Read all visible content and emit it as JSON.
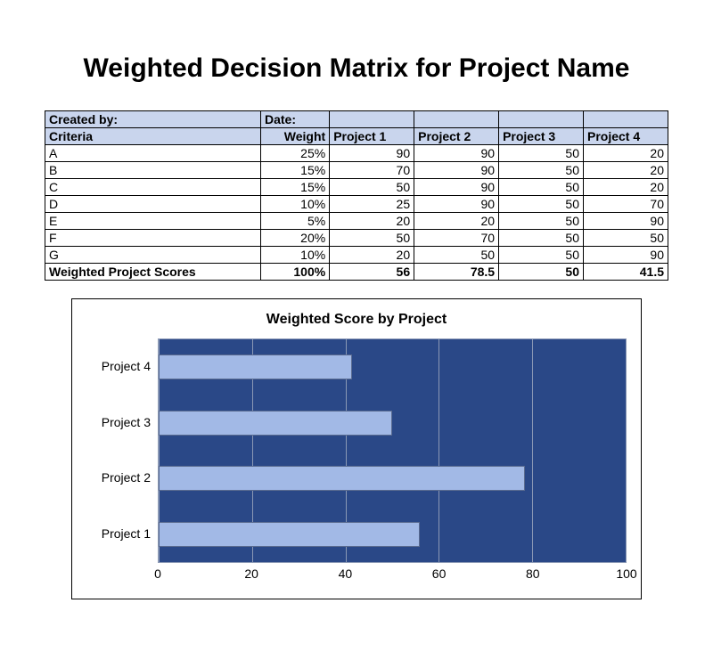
{
  "title": "Weighted Decision Matrix for Project Name",
  "meta": {
    "created_by_label": "Created by:",
    "date_label": "Date:"
  },
  "table": {
    "headers": {
      "criteria": "Criteria",
      "weight": "Weight",
      "p1": "Project 1",
      "p2": "Project 2",
      "p3": "Project 3",
      "p4": "Project 4"
    },
    "rows": [
      {
        "criteria": "A",
        "weight": "25%",
        "p1": "90",
        "p2": "90",
        "p3": "50",
        "p4": "20"
      },
      {
        "criteria": "B",
        "weight": "15%",
        "p1": "70",
        "p2": "90",
        "p3": "50",
        "p4": "20"
      },
      {
        "criteria": "C",
        "weight": "15%",
        "p1": "50",
        "p2": "90",
        "p3": "50",
        "p4": "20"
      },
      {
        "criteria": "D",
        "weight": "10%",
        "p1": "25",
        "p2": "90",
        "p3": "50",
        "p4": "70"
      },
      {
        "criteria": "E",
        "weight": "5%",
        "p1": "20",
        "p2": "20",
        "p3": "50",
        "p4": "90"
      },
      {
        "criteria": "F",
        "weight": "20%",
        "p1": "50",
        "p2": "70",
        "p3": "50",
        "p4": "50"
      },
      {
        "criteria": "G",
        "weight": "10%",
        "p1": "20",
        "p2": "50",
        "p3": "50",
        "p4": "90"
      }
    ],
    "totals": {
      "label": " Weighted Project Scores",
      "weight": "100%",
      "p1": "56",
      "p2": "78.5",
      "p3": "50",
      "p4": "41.5"
    }
  },
  "chart_data": {
    "type": "bar",
    "orientation": "horizontal",
    "title": "Weighted Score by Project",
    "xlabel": "",
    "ylabel": "",
    "xlim": [
      0,
      100
    ],
    "xticks": [
      0,
      20,
      40,
      60,
      80,
      100
    ],
    "categories": [
      "Project 4",
      "Project 3",
      "Project 2",
      "Project 1"
    ],
    "values": [
      41.5,
      50,
      78.5,
      56
    ],
    "colors": {
      "plot_bg": "#2a4887",
      "bar_fill": "#a2b9e6",
      "gridline": "#8a98b5"
    }
  }
}
